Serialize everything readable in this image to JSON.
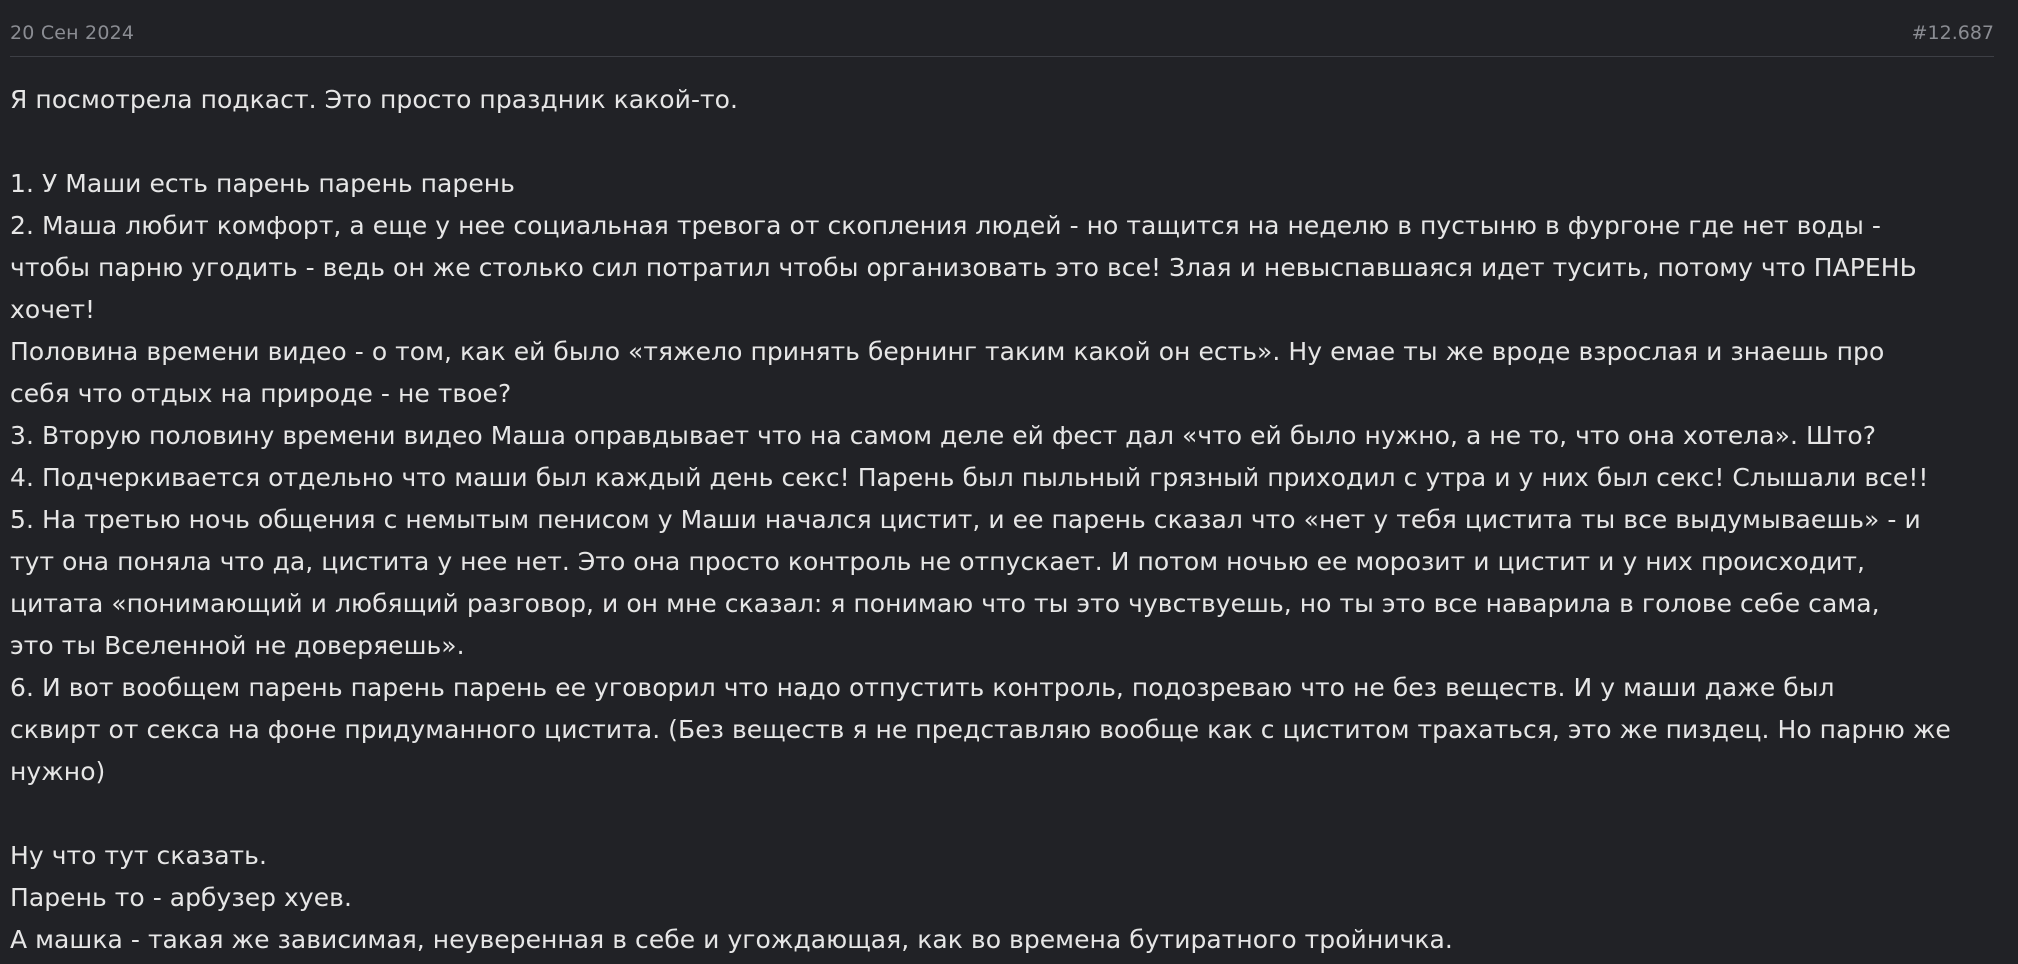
{
  "post": {
    "date": "20 Сен 2024",
    "number": "#12.687",
    "lines": [
      "Я посмотрела подкаст. Это просто праздник какой-то.",
      "",
      "1. У Маши есть парень парень парень",
      "2. Маша любит комфорт, а еще у нее социальная тревога от скопления людей - но тащится на неделю в пустыню в фургоне где нет воды -",
      "чтобы парню угодить - ведь он же столько сил потратил чтобы организовать это все! Злая и невыспавшаяся идет тусить, потому что ПАРЕНЬ",
      "хочет!",
      "Половина времени видео - о том, как ей было «тяжело принять бернинг таким какой он есть». Ну емае ты же вроде взрослая и знаешь про",
      "себя что отдых на природе - не твое?",
      "3. Вторую половину времени видео Маша оправдывает что на самом деле ей фест дал «что ей было нужно, а не то, что она хотела». Што?",
      "4. Подчеркивается отдельно что маши был каждый день секс! Парень был пыльный грязный приходил с утра и у них был секс! Слышали все!!",
      "5. На третью ночь общения с немытым пенисом у Маши начался цистит, и ее парень сказал что «нет у тебя цистита ты все выдумываешь» - и",
      "тут она поняла что да, цистита у нее нет. Это она просто контроль не отпускает. И потом ночью ее морозит и цистит и у них происходит,",
      "цитата «понимающий и любящий разговор, и он мне сказал: я понимаю что ты это чувствуешь, но ты это все наварила в голове себе сама,",
      "это ты Вселенной не доверяешь».",
      "6. И вот вообщем парень парень парень ее уговорил что надо отпустить контроль, подозреваю что не без веществ. И у маши даже был",
      "сквирт от секса на фоне придуманного цистита. (Без веществ я не представляю вообще как с циститом трахаться, это же пиздец. Но парню же",
      "нужно)",
      "",
      "Ну что тут сказать.",
      "Парень то - арбузер хуев.",
      "А машка - такая же зависимая, неуверенная в себе и угождающая, как во времена бутиратного тройничка."
    ]
  }
}
